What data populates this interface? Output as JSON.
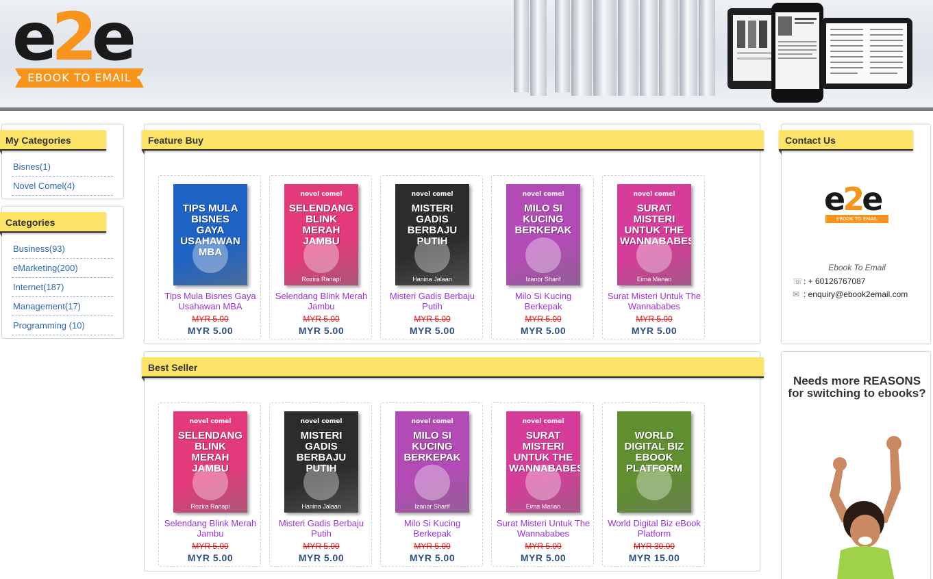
{
  "header": {
    "logo_mark_e1": "e",
    "logo_mark_2": "2",
    "logo_mark_e2": "e",
    "logo_tagline": "• EBOOK TO EMAIL •"
  },
  "my_categories": {
    "title": "My Categories",
    "items": [
      "Bisnes(1)",
      "Novel Comel(4)"
    ]
  },
  "categories": {
    "title": "Categories",
    "items": [
      "Business(93)",
      "eMarketing(200)",
      "Internet(187)",
      "Management(17)",
      "Programming (10)"
    ]
  },
  "feature_buy": {
    "title": "Feature Buy",
    "products": [
      {
        "name": "Tips Mula Bisnes Gaya Usahawan MBA",
        "old_price": "MYR 5.00",
        "price": "MYR 5.00",
        "cover_top": "",
        "cover_title": "TIPS MULA BISNES GAYA USAHAWAN MBA",
        "cover_author": "",
        "cover_color": "#1e63c4"
      },
      {
        "name": "Selendang Blink Merah Jambu",
        "old_price": "MYR 5.00",
        "price": "MYR 5.00",
        "cover_top": "novel comel",
        "cover_title": "SELENDANG BLINK MERAH JAMBU",
        "cover_author": "Rozira Ranapi",
        "cover_color": "#e23a7a"
      },
      {
        "name": "Misteri Gadis Berbaju Putih",
        "old_price": "MYR 5.00",
        "price": "MYR 5.00",
        "cover_top": "novel comel",
        "cover_title": "MISTERI Gadis Berbaju Putih",
        "cover_author": "Hanina Jalaan",
        "cover_color": "#2c2c2e"
      },
      {
        "name": "Milo Si Kucing Berkepak",
        "old_price": "MYR 5.00",
        "price": "MYR 5.00",
        "cover_top": "novel comel",
        "cover_title": "MILO Si Kucing Berkepak",
        "cover_author": "Izanor Sharif",
        "cover_color": "#b24bb5"
      },
      {
        "name": "Surat Misteri Untuk The Wannababes",
        "old_price": "MYR 5.00",
        "price": "MYR 5.00",
        "cover_top": "novel comel",
        "cover_title": "Surat Misteri UNTUK THE WANNABABES",
        "cover_author": "Eima Manan",
        "cover_color": "#d63c9a"
      }
    ]
  },
  "best_seller": {
    "title": "Best Seller",
    "products": [
      {
        "name": "Selendang Blink Merah Jambu",
        "old_price": "MYR 5.00",
        "price": "MYR 5.00",
        "cover_top": "novel comel",
        "cover_title": "SELENDANG BLINK MERAH JAMBU",
        "cover_author": "Rozira Ranapi",
        "cover_color": "#e23a7a"
      },
      {
        "name": "Misteri Gadis Berbaju Putih",
        "old_price": "MYR 5.00",
        "price": "MYR 5.00",
        "cover_top": "novel comel",
        "cover_title": "MISTERI Gadis Berbaju Putih",
        "cover_author": "Hanina Jalaan",
        "cover_color": "#2c2c2e"
      },
      {
        "name": "Milo Si Kucing Berkepak",
        "old_price": "MYR 5.00",
        "price": "MYR 5.00",
        "cover_top": "novel comel",
        "cover_title": "MILO Si Kucing Berkepak",
        "cover_author": "Izanor Sharif",
        "cover_color": "#b24bb5"
      },
      {
        "name": "Surat Misteri Untuk The Wannababes",
        "old_price": "MYR 5.00",
        "price": "MYR 5.00",
        "cover_top": "novel comel",
        "cover_title": "Surat Misteri UNTUK THE WANNABABES",
        "cover_author": "Eima Manan",
        "cover_color": "#d63c9a"
      },
      {
        "name": "World Digital Biz eBook Platform",
        "old_price": "MYR 30.00",
        "price": "MYR 15.00",
        "cover_top": "",
        "cover_title": "World Digital Biz eBook Platform",
        "cover_author": "",
        "cover_color": "#5f8f2e"
      }
    ]
  },
  "contact": {
    "title": "Contact Us",
    "name": "Ebook To Email",
    "phone": ": + 60126767087",
    "email": ": enquiry@ebook2email.com",
    "logo_tagline": "EBOOK TO EMAIL"
  },
  "promo": {
    "headline_line1": "Needs more REASONS",
    "headline_line2": "for switching to ebooks?"
  },
  "icons": {
    "phone": "phone-icon",
    "mail": "mail-icon"
  }
}
